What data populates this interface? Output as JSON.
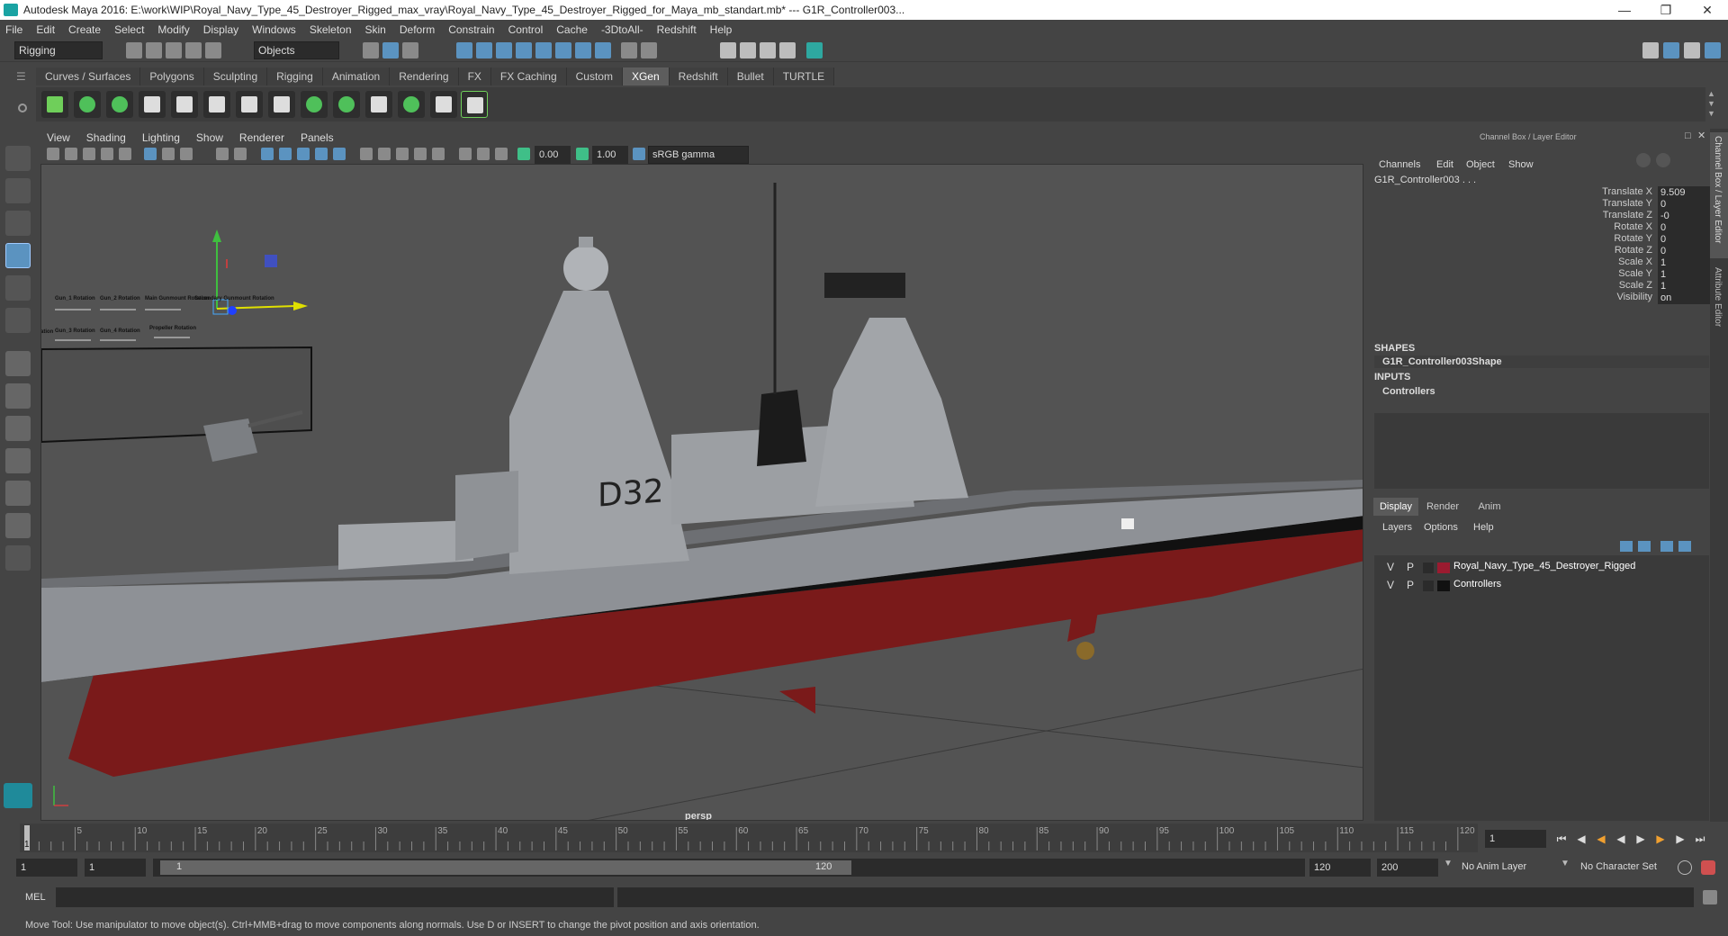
{
  "title": "Autodesk Maya 2016: E:\\work\\WIP\\Royal_Navy_Type_45_Destroyer_Rigged_max_vray\\Royal_Navy_Type_45_Destroyer_Rigged_for_Maya_mb_standart.mb*  ---  G1R_Controller003...",
  "menu": [
    "File",
    "Edit",
    "Create",
    "Select",
    "Modify",
    "Display",
    "Windows",
    "Skeleton",
    "Skin",
    "Deform",
    "Constrain",
    "Control",
    "Cache",
    "-3DtoAll-",
    "Redshift",
    "Help"
  ],
  "status": {
    "menuset": "Rigging",
    "selection_mode": "Objects"
  },
  "shelf_tabs": [
    "Curves / Surfaces",
    "Polygons",
    "Sculpting",
    "Rigging",
    "Animation",
    "Rendering",
    "FX",
    "FX Caching",
    "Custom",
    "XGen",
    "Redshift",
    "Bullet",
    "TURTLE"
  ],
  "active_shelf": "XGen",
  "viewport": {
    "menu": [
      "View",
      "Shading",
      "Lighting",
      "Show",
      "Renderer",
      "Panels"
    ],
    "near": "0.00",
    "far": "1.00",
    "colorspace": "sRGB gamma",
    "camera": "persp",
    "hull_label": "D32",
    "control_labels": [
      "Gun_1 Rotation",
      "Gun_2 Rotation",
      "Main Gunmount Rotation",
      "Secondary Gunmount Rotation",
      "Gun_3 Rotation",
      "Gun_4 Rotation",
      "Propeller Rotation"
    ],
    "left_cut": "ation"
  },
  "channel_box": {
    "header": "Channel Box / Layer Editor",
    "menu": [
      "Channels",
      "Edit",
      "Object",
      "Show"
    ],
    "node": "G1R_Controller003 . . .",
    "attrs": [
      {
        "label": "Translate X",
        "value": "9.509"
      },
      {
        "label": "Translate Y",
        "value": "0"
      },
      {
        "label": "Translate Z",
        "value": "-0"
      },
      {
        "label": "Rotate X",
        "value": "0"
      },
      {
        "label": "Rotate Y",
        "value": "0"
      },
      {
        "label": "Rotate Z",
        "value": "0"
      },
      {
        "label": "Scale X",
        "value": "1"
      },
      {
        "label": "Scale Y",
        "value": "1"
      },
      {
        "label": "Scale Z",
        "value": "1"
      },
      {
        "label": "Visibility",
        "value": "on"
      }
    ],
    "shapes_title": "SHAPES",
    "shape_node": "G1R_Controller003Shape",
    "inputs_title": "INPUTS",
    "input_node": "Controllers"
  },
  "layer_editor": {
    "tabs": [
      "Display",
      "Render",
      "Anim"
    ],
    "menu": [
      "Layers",
      "Options",
      "Help"
    ],
    "layers": [
      {
        "v": "V",
        "p": "P",
        "color": "#9b1b30",
        "name": "Royal_Navy_Type_45_Destroyer_Rigged"
      },
      {
        "v": "V",
        "p": "P",
        "color": "#111111",
        "name": "Controllers"
      }
    ]
  },
  "side_tabs": [
    "Channel Box / Layer Editor",
    "Attribute Editor"
  ],
  "timeline": {
    "ticks": [
      "5",
      "10",
      "15",
      "20",
      "25",
      "30",
      "35",
      "40",
      "45",
      "50",
      "55",
      "60",
      "65",
      "70",
      "75",
      "80",
      "85",
      "90",
      "95",
      "100",
      "105",
      "110",
      "115",
      "120"
    ],
    "first": "1",
    "current_frame": "1"
  },
  "range": {
    "start": "1",
    "anim_start": "1",
    "slider_start": "1",
    "slider_end": "120",
    "end": "120",
    "anim_end": "200",
    "anim_layer": "No Anim Layer",
    "char_set": "No Character Set"
  },
  "cmd": {
    "label": "MEL"
  },
  "help_line": "Move Tool: Use manipulator to move object(s). Ctrl+MMB+drag to move components along normals. Use D or INSERT to change the pivot position and axis orientation."
}
